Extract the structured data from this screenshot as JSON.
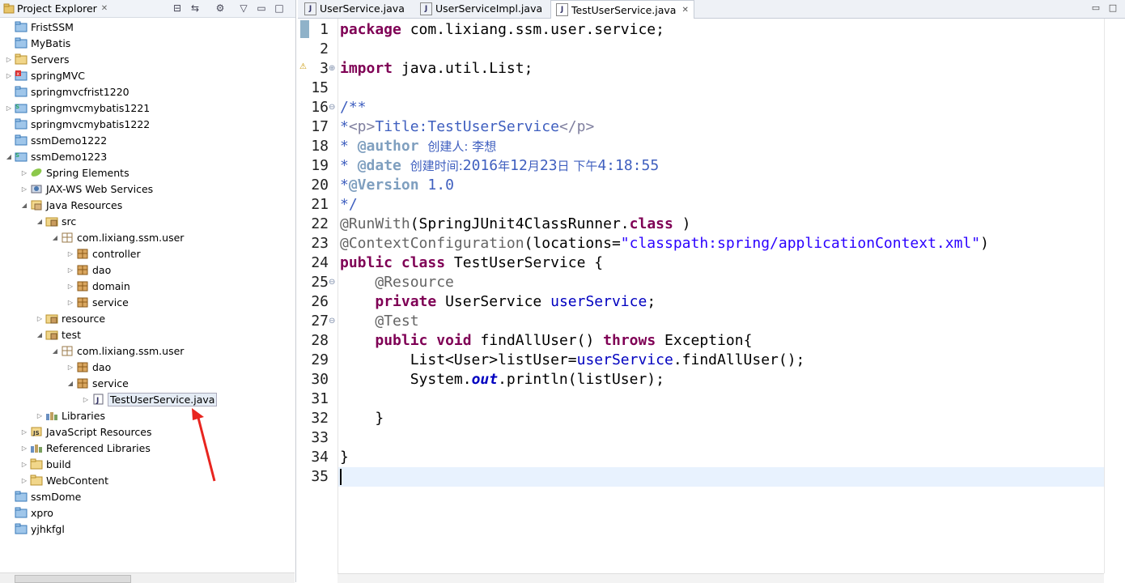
{
  "explorer": {
    "title": "Project Explorer",
    "close_glyph": "✕",
    "tree": [
      {
        "label": "FristSSM",
        "depth": 0,
        "twisty": "",
        "icon": "project"
      },
      {
        "label": "MyBatis",
        "depth": 0,
        "twisty": "",
        "icon": "project"
      },
      {
        "label": "Servers",
        "depth": 0,
        "twisty": "▷",
        "icon": "folder"
      },
      {
        "label": "springMVC",
        "depth": 0,
        "twisty": "▷",
        "icon": "project-error"
      },
      {
        "label": "springmvcfrist1220",
        "depth": 0,
        "twisty": "",
        "icon": "project"
      },
      {
        "label": "springmvcmybatis1221",
        "depth": 0,
        "twisty": "▷",
        "icon": "project-spring"
      },
      {
        "label": "springmvcmybatis1222",
        "depth": 0,
        "twisty": "",
        "icon": "project"
      },
      {
        "label": "ssmDemo1222",
        "depth": 0,
        "twisty": "",
        "icon": "project"
      },
      {
        "label": "ssmDemo1223",
        "depth": 0,
        "twisty": "◢",
        "icon": "project-spring"
      },
      {
        "label": "Spring Elements",
        "depth": 1,
        "twisty": "▷",
        "icon": "spring"
      },
      {
        "label": "JAX-WS Web Services",
        "depth": 1,
        "twisty": "▷",
        "icon": "jaxws"
      },
      {
        "label": "Java Resources",
        "depth": 1,
        "twisty": "◢",
        "icon": "java-res"
      },
      {
        "label": "src",
        "depth": 2,
        "twisty": "◢",
        "icon": "src-folder"
      },
      {
        "label": "com.lixiang.ssm.user",
        "depth": 3,
        "twisty": "◢",
        "icon": "package-empty"
      },
      {
        "label": "controller",
        "depth": 4,
        "twisty": "▷",
        "icon": "package"
      },
      {
        "label": "dao",
        "depth": 4,
        "twisty": "▷",
        "icon": "package"
      },
      {
        "label": "domain",
        "depth": 4,
        "twisty": "▷",
        "icon": "package"
      },
      {
        "label": "service",
        "depth": 4,
        "twisty": "▷",
        "icon": "package"
      },
      {
        "label": "resource",
        "depth": 2,
        "twisty": "▷",
        "icon": "src-folder"
      },
      {
        "label": "test",
        "depth": 2,
        "twisty": "◢",
        "icon": "src-folder"
      },
      {
        "label": "com.lixiang.ssm.user",
        "depth": 3,
        "twisty": "◢",
        "icon": "package-empty"
      },
      {
        "label": "dao",
        "depth": 4,
        "twisty": "▷",
        "icon": "package"
      },
      {
        "label": "service",
        "depth": 4,
        "twisty": "◢",
        "icon": "package"
      },
      {
        "label": "TestUserService.java",
        "depth": 5,
        "twisty": "▷",
        "icon": "java-file",
        "selected": true
      },
      {
        "label": "Libraries",
        "depth": 2,
        "twisty": "▷",
        "icon": "library"
      },
      {
        "label": "JavaScript Resources",
        "depth": 1,
        "twisty": "▷",
        "icon": "js-res"
      },
      {
        "label": "Referenced Libraries",
        "depth": 1,
        "twisty": "▷",
        "icon": "library"
      },
      {
        "label": "build",
        "depth": 1,
        "twisty": "▷",
        "icon": "folder"
      },
      {
        "label": "WebContent",
        "depth": 1,
        "twisty": "▷",
        "icon": "folder"
      },
      {
        "label": "ssmDome",
        "depth": 0,
        "twisty": "",
        "icon": "project"
      },
      {
        "label": "xpro",
        "depth": 0,
        "twisty": "",
        "icon": "project"
      },
      {
        "label": "yjhkfgl",
        "depth": 0,
        "twisty": "",
        "icon": "project"
      }
    ]
  },
  "editor": {
    "tabs": [
      {
        "label": "UserService.java",
        "active": false
      },
      {
        "label": "UserServiceImpl.java",
        "active": false
      },
      {
        "label": "TestUserService.java",
        "active": true,
        "close": "✕"
      }
    ],
    "lines": [
      {
        "num": "1",
        "fold": "",
        "tokens": [
          [
            "kw",
            "package"
          ],
          [
            "",
            "com.lixiang.ssm.user.service;"
          ]
        ]
      },
      {
        "num": "2",
        "fold": "",
        "tokens": []
      },
      {
        "num": "3",
        "fold": "⊕",
        "tokens": [
          [
            "kw",
            "import"
          ],
          [
            "",
            "java.util.List;"
          ]
        ]
      },
      {
        "num": "15",
        "fold": "",
        "tokens": []
      },
      {
        "num": "16",
        "fold": "⊖",
        "tokens": [
          [
            "cm",
            "/**"
          ]
        ]
      },
      {
        "num": "17",
        "fold": "",
        "tokens": [
          [
            "cm",
            "*"
          ],
          [
            "tag",
            "<p>"
          ],
          [
            "cm",
            "Title:TestUserService"
          ],
          [
            "tag",
            "</p>"
          ]
        ]
      },
      {
        "num": "18",
        "fold": "",
        "tokens": [
          [
            "cm",
            "* "
          ],
          [
            "jdtag",
            "@author"
          ],
          [
            "cm",
            ""
          ],
          [
            "cm cjk",
            "创建人: 李想"
          ]
        ]
      },
      {
        "num": "19",
        "fold": "",
        "tokens": [
          [
            "cm",
            "* "
          ],
          [
            "jdtag",
            "@date"
          ],
          [
            "cm",
            ""
          ],
          [
            "cm cjk",
            "创建时间:"
          ],
          [
            "cm",
            "2016"
          ],
          [
            "cm cjk",
            "年"
          ],
          [
            "cm",
            "12"
          ],
          [
            "cm cjk",
            "月"
          ],
          [
            "cm",
            "23"
          ],
          [
            "cm cjk",
            "日 下午"
          ],
          [
            "cm",
            "4:18:55"
          ]
        ]
      },
      {
        "num": "20",
        "fold": "",
        "tokens": [
          [
            "cm",
            "*"
          ],
          [
            "jdtag",
            "@Version"
          ],
          [
            "cm",
            "1.0"
          ]
        ]
      },
      {
        "num": "21",
        "fold": "",
        "tokens": [
          [
            "cm",
            "*/"
          ]
        ]
      },
      {
        "num": "22",
        "fold": "",
        "tokens": [
          [
            "ann",
            "@RunWith"
          ],
          [
            "",
            "(SpringJUnit4ClassRunner."
          ],
          [
            "kw",
            "class"
          ],
          [
            "",
            ")"
          ]
        ]
      },
      {
        "num": "23",
        "fold": "",
        "tokens": [
          [
            "ann",
            "@ContextConfiguration"
          ],
          [
            "",
            "(locations="
          ],
          [
            "str",
            "\"classpath:spring/applicationContext.xml\""
          ],
          [
            "",
            ")"
          ]
        ]
      },
      {
        "num": "24",
        "fold": "",
        "tokens": [
          [
            "kw",
            "public"
          ],
          [
            "kw",
            "class"
          ],
          [
            "",
            "TestUserService {"
          ]
        ]
      },
      {
        "num": "25",
        "fold": "⊖",
        "tokens": [
          [
            "",
            "    "
          ],
          [
            "ann",
            "@Resource"
          ]
        ]
      },
      {
        "num": "26",
        "fold": "",
        "tokens": [
          [
            "",
            "    "
          ],
          [
            "kw",
            "private"
          ],
          [
            "",
            "UserService "
          ],
          [
            "fld",
            "userService"
          ],
          [
            "",
            ";"
          ]
        ]
      },
      {
        "num": "27",
        "fold": "⊖",
        "tokens": [
          [
            "",
            "    "
          ],
          [
            "ann",
            "@Test"
          ]
        ]
      },
      {
        "num": "28",
        "fold": "",
        "tokens": [
          [
            "",
            "    "
          ],
          [
            "kw",
            "public"
          ],
          [
            "kw",
            "void"
          ],
          [
            "",
            "findAllUser() "
          ],
          [
            "kw",
            "throws"
          ],
          [
            "",
            "Exception{"
          ]
        ]
      },
      {
        "num": "29",
        "fold": "",
        "tokens": [
          [
            "",
            "        List<User>listUser="
          ],
          [
            "fld",
            "userService"
          ],
          [
            "",
            ".findAllUser();"
          ]
        ]
      },
      {
        "num": "30",
        "fold": "",
        "tokens": [
          [
            "",
            "        System."
          ],
          [
            "sfld",
            "out"
          ],
          [
            "",
            ".println(listUser);"
          ]
        ]
      },
      {
        "num": "31",
        "fold": "",
        "tokens": []
      },
      {
        "num": "32",
        "fold": "",
        "tokens": [
          [
            "",
            "    }"
          ]
        ]
      },
      {
        "num": "33",
        "fold": "",
        "tokens": []
      },
      {
        "num": "34",
        "fold": "",
        "tokens": [
          [
            "",
            "}"
          ]
        ]
      },
      {
        "num": "35",
        "fold": "",
        "tokens": []
      }
    ],
    "current_line": "35"
  },
  "colors": {
    "keyword": "#7f0055",
    "comment": "#3f5fbf",
    "annotation": "#646464",
    "string": "#2a00ff",
    "field": "#0000c0",
    "arrow": "#e8251f"
  }
}
